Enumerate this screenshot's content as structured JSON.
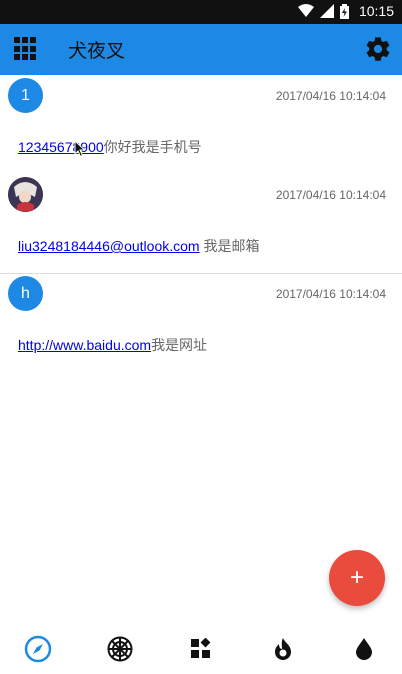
{
  "status_bar": {
    "time": "10:15"
  },
  "app_bar": {
    "title": "犬夜叉",
    "menu_icon": "grid-menu-icon",
    "settings_icon": "gear-icon"
  },
  "messages": [
    {
      "avatar_text": "1",
      "time": "2017/04/16 10:14:04",
      "link": "12345678900",
      "text": "你好我是手机号"
    },
    {
      "avatar_text": "",
      "time": "2017/04/16 10:14:04",
      "link": "liu3248184446@outlook.com",
      "text": " 我是邮箱"
    },
    {
      "avatar_text": "h",
      "time": "2017/04/16 10:14:04",
      "link": "http://www.baidu.com",
      "text": "我是网址"
    }
  ],
  "fab": {
    "label": "+"
  },
  "bottom_nav": [
    {
      "icon": "compass-icon",
      "active": true
    },
    {
      "icon": "empire-icon",
      "active": false
    },
    {
      "icon": "widgets-icon",
      "active": false
    },
    {
      "icon": "flame-icon",
      "active": false
    },
    {
      "icon": "drop-icon",
      "active": false
    }
  ],
  "colors": {
    "primary": "#1e88e5",
    "fab": "#e94b3c",
    "link": "#0000ee"
  }
}
